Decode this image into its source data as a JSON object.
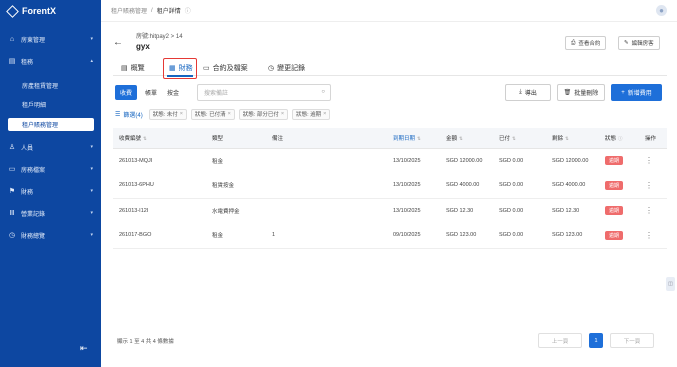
{
  "app": {
    "name": "ForentX"
  },
  "sidebar": {
    "items": [
      {
        "label": "房東管理",
        "icon": "home-icon"
      },
      {
        "label": "租務",
        "icon": "document-icon"
      },
      {
        "label": "房產租賃管理",
        "icon": ""
      },
      {
        "label": "租戶明細",
        "icon": ""
      },
      {
        "label": "租户賬務管理",
        "icon": ""
      },
      {
        "label": "人員",
        "icon": "people-icon"
      },
      {
        "label": "房務檔案",
        "icon": "folder-icon"
      },
      {
        "label": "財務",
        "icon": "flag-icon"
      },
      {
        "label": "營業記錄",
        "icon": "bank-icon"
      },
      {
        "label": "財務總覽",
        "icon": "clock-icon"
      }
    ]
  },
  "breadcrumb": {
    "parent": "租户賬務管理",
    "sep": "/",
    "current": "租户詳情"
  },
  "header": {
    "subtitle": "房號:hitpay2 > 14",
    "title": "gyx",
    "btn_print": "查看合約",
    "btn_edit": "編輯房客"
  },
  "tabs": [
    "概覽",
    "財務",
    "合約及檔案",
    "變更記錄"
  ],
  "toolbar": {
    "segments": [
      "收費",
      "帳單",
      "按金"
    ],
    "search_placeholder": "搜索備註",
    "btn_export": "導出",
    "btn_batch": "批量刪除",
    "btn_new": "新增費用"
  },
  "filters": {
    "label": "篩選(4)",
    "chips": [
      "狀態: 未付",
      "狀態: 已付清",
      "狀態: 部分已付",
      "狀態: 逾期"
    ]
  },
  "table": {
    "columns": [
      "收費編號",
      "類型",
      "備注",
      "到期日期",
      "金額",
      "已付",
      "剩餘",
      "狀態",
      "操作"
    ],
    "rows": [
      {
        "id": "261013-MQJI",
        "type": "租金",
        "note": "",
        "due": "13/10/2025",
        "amount": "SGD 12000.00",
        "paid": "SGD 0.00",
        "remain": "SGD 12000.00",
        "status": "逾期"
      },
      {
        "id": "261013-6PHU",
        "type": "租賃按金",
        "note": "",
        "due": "13/10/2025",
        "amount": "SGD 4000.00",
        "paid": "SGD 0.00",
        "remain": "SGD 4000.00",
        "status": "逾期"
      },
      {
        "id": "261013-I12I",
        "type": "水電費押金",
        "note": "",
        "due": "13/10/2025",
        "amount": "SGD 12.30",
        "paid": "SGD 0.00",
        "remain": "SGD 12.30",
        "status": "逾期"
      },
      {
        "id": "261017-BGO",
        "type": "租金",
        "note": "1",
        "due": "09/10/2025",
        "amount": "SGD 123.00",
        "paid": "SGD 0.00",
        "remain": "SGD 123.00",
        "status": "逾期"
      }
    ]
  },
  "pagination": {
    "info": "顯示 1 至 4 共 4 條數據",
    "prev": "上一頁",
    "page": "1",
    "next": "下一頁"
  },
  "colors": {
    "primary": "#1e6fd9",
    "sidebar": "#0d47a1",
    "danger": "#ef6c6c",
    "highlight": "#e53935"
  }
}
